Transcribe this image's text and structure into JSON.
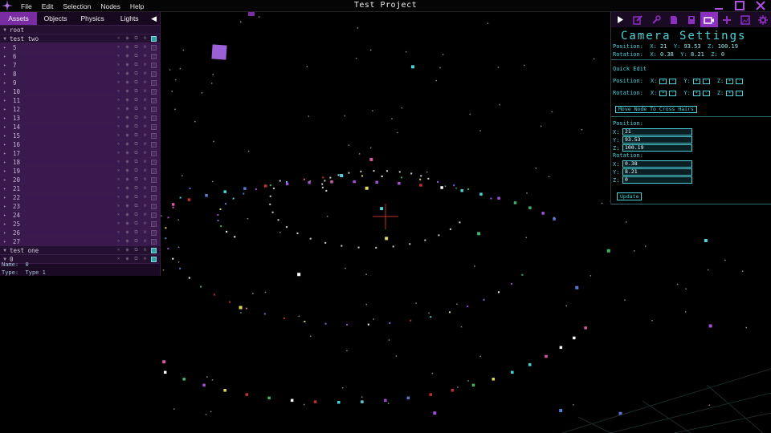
{
  "window": {
    "title": "Test Project"
  },
  "menu": [
    "File",
    "Edit",
    "Selection",
    "Nodes",
    "Help"
  ],
  "left_panel": {
    "tabs": [
      {
        "label": "Assets",
        "active": true
      },
      {
        "label": "Objects",
        "active": false
      },
      {
        "label": "Physics",
        "active": false
      },
      {
        "label": "Lights",
        "active": false
      }
    ],
    "collapse_icon": "chevron-left-icon",
    "tree": {
      "root_label": "root",
      "group_one_label": "test two",
      "children": [
        "5",
        "6",
        "7",
        "8",
        "9",
        "10",
        "11",
        "12",
        "13",
        "14",
        "15",
        "16",
        "17",
        "18",
        "19",
        "20",
        "21",
        "22",
        "23",
        "24",
        "25",
        "26",
        "27"
      ],
      "group_two_label": "test one",
      "group_three_label": "0"
    },
    "properties": {
      "name_label": "Name:",
      "name_value": "0",
      "type_label": "Type:",
      "type_value": "Type 1"
    }
  },
  "right_panel": {
    "toolbar_icons": [
      "expand-icon",
      "edit-icon",
      "wrench-icon",
      "file-icon",
      "save-icon",
      "camera-icon",
      "plus-icon",
      "image-icon",
      "gear-icon"
    ],
    "title": "Camera Settings",
    "summary": {
      "position_label": "Position:",
      "position": {
        "x": "21",
        "y": "93.53",
        "z": "100.19"
      },
      "rotation_label": "Rotation:",
      "rotation": {
        "x": "0.38",
        "y": "8.21",
        "z": "0"
      }
    },
    "quick_edit": {
      "heading": "Quick Edit",
      "position_label": "Position:",
      "rotation_label": "Rotation:",
      "axes": [
        "X:",
        "Y:",
        "Z:"
      ],
      "plus": "+",
      "minus": "-"
    },
    "cross_hairs_button": "Move Node To Cross Hairs",
    "fields": {
      "position_label": "Position:",
      "position": {
        "x": "21",
        "y": "93.53",
        "z": "100.19"
      },
      "rotation_label": "Rotation:",
      "rotation": {
        "x": "0.38",
        "y": "8.21",
        "z": "0"
      }
    },
    "update_button": "Update"
  },
  "colors": {
    "accent_purple": "#7a2da3",
    "cyan": "#49d4dc",
    "crosshair": "#c0302c"
  }
}
